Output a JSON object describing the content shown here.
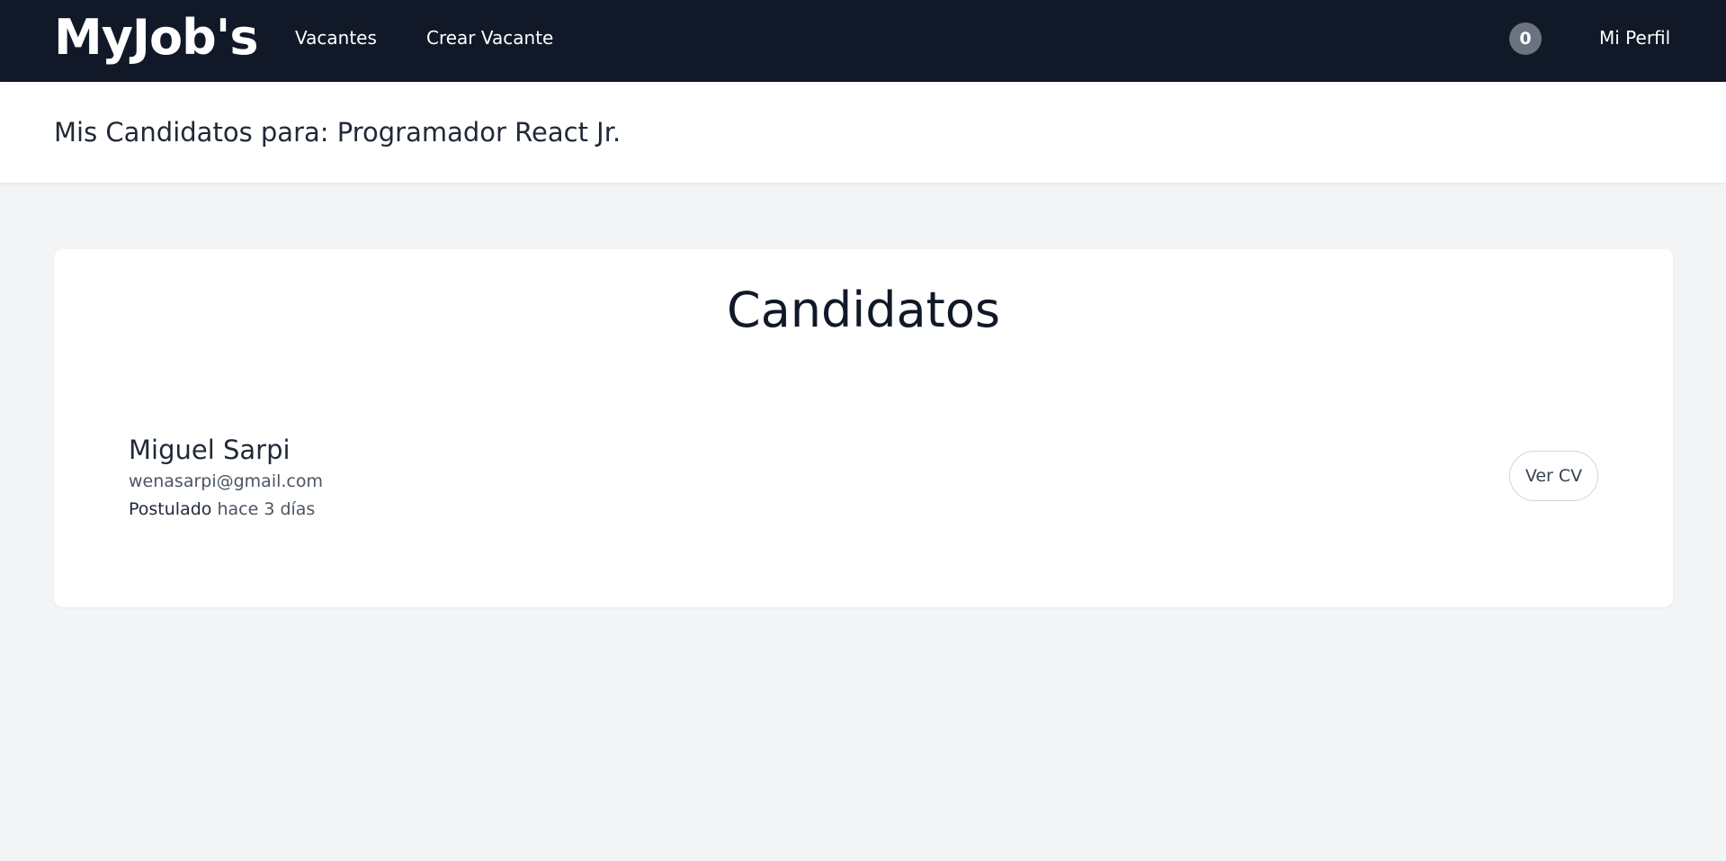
{
  "navbar": {
    "brand": "MyJob's",
    "links": {
      "vacantes": "Vacantes",
      "crear_vacante": "Crear Vacante",
      "mi_perfil": "Mi Perfil"
    },
    "notifications_count": "0"
  },
  "header": {
    "title": "Mis Candidatos para: Programador React Jr."
  },
  "main": {
    "card_title": "Candidatos",
    "candidates": [
      {
        "name": "Miguel Sarpi",
        "email": "wenasarpi@gmail.com",
        "posted_label": "Postulado",
        "posted_time": "hace 3 días",
        "cv_button_label": "Ver CV"
      }
    ]
  },
  "colors": {
    "navbar_bg": "#111827",
    "page_bg": "#f3f4f6",
    "badge_bg": "#6b7280"
  }
}
